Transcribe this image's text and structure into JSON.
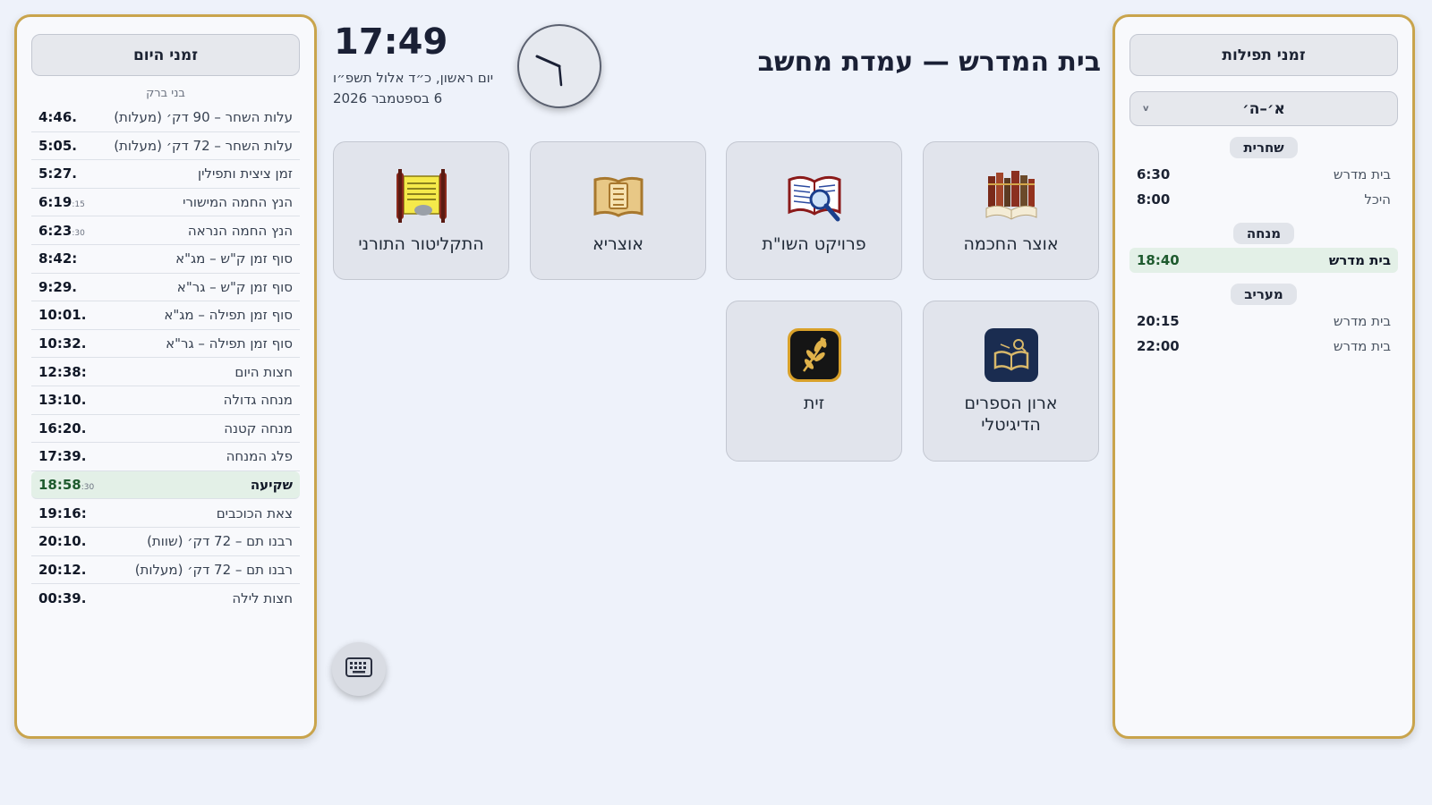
{
  "header": {
    "title": "בית המדרש — עמדת מחשב",
    "time": "17:49",
    "hebrew_date": "יום ראשון, כ״ד אלול תשפ״ו",
    "gregorian_date": "6 בספטמבר 2026"
  },
  "zmanim": {
    "title": "זמני היום",
    "location": "בני ברק",
    "rows": [
      {
        "name": "עלות השחר – 90 דק׳ (מעלות)",
        "time": "4:46.",
        "sec": ""
      },
      {
        "name": "עלות השחר – 72 דק׳ (מעלות)",
        "time": "5:05.",
        "sec": ""
      },
      {
        "name": "זמן ציצית ותפילין",
        "time": "5:27.",
        "sec": ""
      },
      {
        "name": "הנץ החמה המישורי",
        "time": "6:19",
        "sec": ":15"
      },
      {
        "name": "הנץ החמה הנראה",
        "time": "6:23",
        "sec": ":30"
      },
      {
        "name": "סוף זמן ק\"ש – מג\"א",
        "time": "8:42:",
        "sec": ""
      },
      {
        "name": "סוף זמן ק\"ש – גר\"א",
        "time": "9:29.",
        "sec": ""
      },
      {
        "name": "סוף זמן תפילה – מג\"א",
        "time": "10:01.",
        "sec": ""
      },
      {
        "name": "סוף זמן תפילה – גר\"א",
        "time": "10:32.",
        "sec": ""
      },
      {
        "name": "חצות היום",
        "time": "12:38:",
        "sec": ""
      },
      {
        "name": "מנחה גדולה",
        "time": "13:10.",
        "sec": ""
      },
      {
        "name": "מנחה קטנה",
        "time": "16:20.",
        "sec": ""
      },
      {
        "name": "פלג המנחה",
        "time": "17:39.",
        "sec": ""
      },
      {
        "name": "שקיעה",
        "time": "18:58",
        "sec": ":30"
      },
      {
        "name": "צאת הכוכבים",
        "time": "19:16:",
        "sec": ""
      },
      {
        "name": "רבנו תם – 72 דק׳ (שוות)",
        "time": "20:10.",
        "sec": ""
      },
      {
        "name": "רבנו תם – 72 דק׳ (מעלות)",
        "time": "20:12.",
        "sec": ""
      },
      {
        "name": "חצות לילה",
        "time": "00:39.",
        "sec": ""
      }
    ]
  },
  "prayers": {
    "title": "זמני תפילות",
    "day_selector": "א׳–ה׳",
    "sections": [
      {
        "name": "שחרית",
        "rows": [
          {
            "place": "בית מדרש",
            "time": "6:30"
          },
          {
            "place": "היכל",
            "time": "8:00"
          }
        ]
      },
      {
        "name": "מנחה",
        "rows": [
          {
            "place": "בית מדרש",
            "time": "18:40"
          }
        ]
      },
      {
        "name": "מעריב",
        "rows": [
          {
            "place": "בית מדרש",
            "time": "20:15"
          },
          {
            "place": "בית מדרש",
            "time": "22:00"
          }
        ]
      }
    ]
  },
  "apps": [
    {
      "label": "אוצר החכמה",
      "icon": "books-icon"
    },
    {
      "label": "פרויקט השו\"ת",
      "icon": "magnifier-book-icon"
    },
    {
      "label": "אוצריא",
      "icon": "gold-book-icon"
    },
    {
      "label": "התקליטור התורני",
      "icon": "torah-scroll-icon"
    },
    {
      "label": "ארון הספרים הדיגיטלי",
      "icon": "digital-bookshelf-icon"
    },
    {
      "label": "זית",
      "icon": "olive-branch-icon"
    }
  ],
  "keyboard_button": {
    "icon": "keyboard-icon"
  },
  "colors": {
    "accent_border": "#c9a44c",
    "highlight_bg": "#e3f0e7",
    "highlight_text": "#1e5a2e",
    "background": "#eef2fa"
  }
}
